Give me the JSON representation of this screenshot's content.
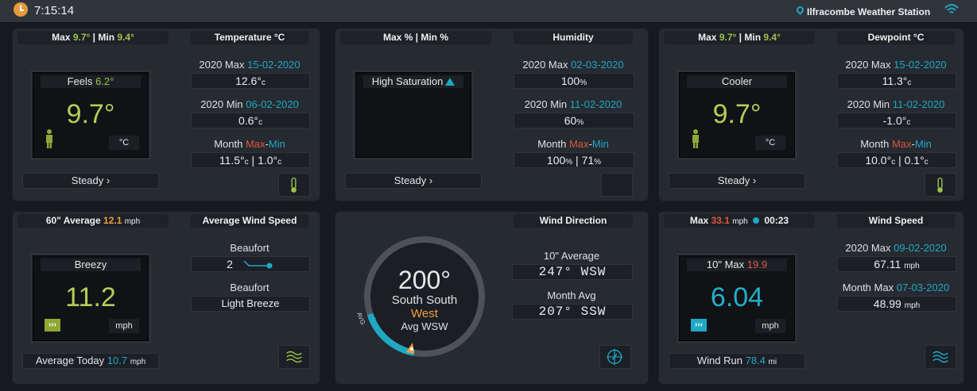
{
  "topbar": {
    "time": "7:15:14",
    "station": "Ilfracombe Weather Station",
    "icons": {
      "clock": "clock-icon",
      "pin": "map-pin-icon",
      "wifi": "wifi-icon"
    }
  },
  "colors": {
    "accent_blue": "#1fa8c4",
    "accent_green": "#9ac24a",
    "accent_red": "#e0553f",
    "accent_orange": "#f0a040",
    "panel": "#262a31"
  },
  "temperature": {
    "title": "Temperature °C",
    "max_label": "Max",
    "max_value": "9.7°",
    "sep": "|",
    "min_label": "Min",
    "min_value": "9.4°",
    "feels_label": "Feels",
    "feels_value": "6.2°",
    "value": "9.7°",
    "unit": "°C",
    "year_max_label": "2020 Max",
    "year_max_date": "15-02-2020",
    "year_max_value": "12.6°",
    "year_max_unit": "c",
    "year_min_label": "2020 Min",
    "year_min_date": "06-02-2020",
    "year_min_value": "0.6°",
    "year_min_unit": "c",
    "month_label": "Month",
    "month_max_word": "Max",
    "month_dash": "-",
    "month_min_word": "Min",
    "month_max_value": "11.5°",
    "month_min_value": "1.0°",
    "month_unit": "c",
    "trend": "Steady ›"
  },
  "humidity": {
    "title": "Humidity",
    "header": "Max % | Min %",
    "status": "High Saturation",
    "year_max_label": "2020 Max",
    "year_max_date": "02-03-2020",
    "year_max_value": "100",
    "year_max_unit": "%",
    "year_min_label": "2020 Min",
    "year_min_date": "11-02-2020",
    "year_min_value": "60",
    "year_min_unit": "%",
    "month_label": "Month",
    "month_max_word": "Max",
    "month_dash": "-",
    "month_min_word": "Min",
    "month_max_value": "100",
    "month_min_value": "71",
    "month_unit": "%",
    "trend": "Steady ›"
  },
  "dewpoint": {
    "title": "Dewpoint °C",
    "max_label": "Max",
    "max_value": "9.7°",
    "sep": "|",
    "min_label": "Min",
    "min_value": "9.4°",
    "status": "Cooler",
    "value": "9.7°",
    "unit": "°C",
    "year_max_label": "2020 Max",
    "year_max_date": "15-02-2020",
    "year_max_value": "11.3°",
    "year_max_unit": "c",
    "year_min_label": "2020 Min",
    "year_min_date": "11-02-2020",
    "year_min_value": "-1.0°",
    "year_min_unit": "c",
    "month_label": "Month",
    "month_max_word": "Max",
    "month_dash": "-",
    "month_min_word": "Min",
    "month_max_value": "10.0°",
    "month_min_value": "0.1°",
    "month_unit": "c",
    "trend": "Steady ›"
  },
  "avg_wind": {
    "title": "Average Wind Speed",
    "avg_label": "60\" Average",
    "avg_value": "12.1",
    "avg_unit": "mph",
    "status": "Breezy",
    "value": "11.2",
    "unit": "mph",
    "badge": "›››",
    "beaufort_label": "Beaufort",
    "beaufort_value": "2",
    "beaufort_desc_label": "Beaufort",
    "beaufort_desc": "Light Breeze",
    "today_label": "Average Today",
    "today_value": "10.7",
    "today_unit": "mph"
  },
  "wind_dir": {
    "title": "Wind Direction",
    "degrees": "200°",
    "line1": "South South",
    "line2": "West",
    "avg": "Avg WSW",
    "avg_marker": "AVG",
    "ten_avg_label": "10\" Average",
    "ten_avg_value": "247°  WSW",
    "month_avg_label": "Month Avg",
    "month_avg_value": "207°  SSW"
  },
  "wind_speed": {
    "title": "Wind Speed",
    "max_label": "Max",
    "max_value": "33.1",
    "max_unit": "mph",
    "max_time": "00:23",
    "ten_max_label": "10\" Max",
    "ten_max_value": "19.9",
    "value": "6.04",
    "unit": "mph",
    "badge": "›››",
    "year_max_label": "2020 Max",
    "year_max_date": "09-02-2020",
    "year_max_value": "67.11",
    "year_max_unit": "mph",
    "month_max_label": "Month Max",
    "month_max_date": "07-03-2020",
    "month_max_value": "48.99",
    "month_max_unit": "mph",
    "run_label": "Wind Run",
    "run_value": "78.4",
    "run_unit": "mi"
  }
}
